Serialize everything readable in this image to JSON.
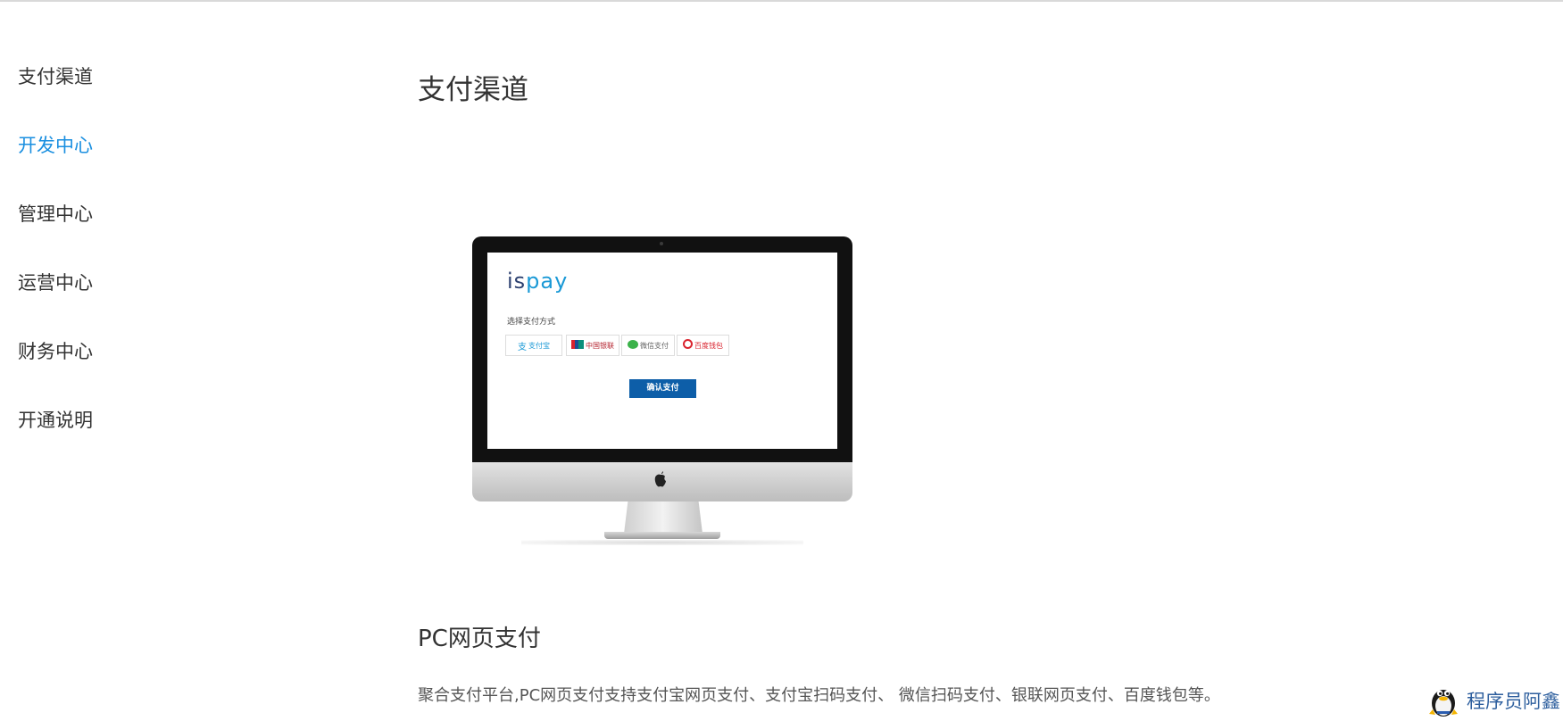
{
  "sidebar": {
    "items": [
      {
        "label": "支付渠道",
        "active": false
      },
      {
        "label": "开发中心",
        "active": true
      },
      {
        "label": "管理中心",
        "active": false
      },
      {
        "label": "运营中心",
        "active": false
      },
      {
        "label": "财务中心",
        "active": false
      },
      {
        "label": "开通说明",
        "active": false
      }
    ]
  },
  "main": {
    "title": "支付渠道",
    "illustration": {
      "logo_part1": "is",
      "logo_part2": "pay",
      "choose_label": "选择支付方式",
      "methods": [
        {
          "icon": "alipay-icon",
          "label": "支付宝"
        },
        {
          "icon": "unionpay-icon",
          "label": "中国银联"
        },
        {
          "icon": "wechat-icon",
          "label": "微信支付"
        },
        {
          "icon": "baidu-wallet-icon",
          "label": "百度钱包"
        }
      ],
      "confirm_label": "确认支付"
    },
    "section_title": "PC网页支付",
    "description": "聚合支付平台,PC网页支付支持支付宝网页支付、支付宝扫码支付、 微信扫码支付、银联网页支付、百度钱包等。"
  },
  "watermark": {
    "text": "程序员阿鑫",
    "icon": "penguin-icon"
  },
  "colors": {
    "active": "#1a8fe0",
    "confirm_button": "#0d5ea8",
    "watermark": "#2e5f9e"
  }
}
